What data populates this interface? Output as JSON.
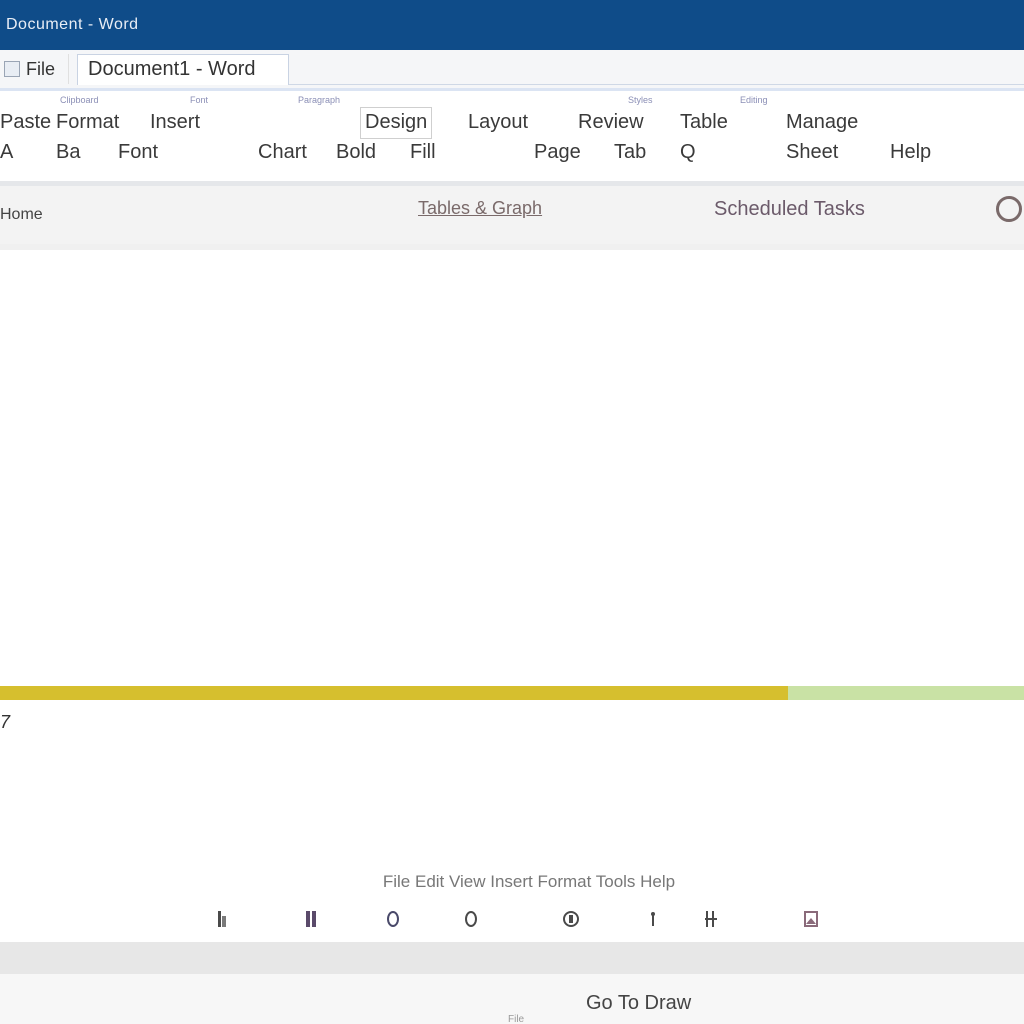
{
  "window": {
    "title": "Document - Word"
  },
  "tabs": {
    "app_tab": "File",
    "active_tab": "Document1 - Word"
  },
  "ribbon": {
    "group_labels": [
      "Clipboard",
      "Font",
      "Paragraph",
      "Styles",
      "Editing"
    ],
    "row1": [
      "Paste",
      "Format",
      "Insert",
      "Design",
      "Layout",
      "Review",
      "Table",
      "Manage"
    ],
    "row2": [
      "A",
      "Ba",
      "Font",
      "Chart",
      "Bold",
      "Fill",
      "Page",
      "Tab",
      "Q",
      "Sheet",
      "Help"
    ]
  },
  "addressbar": {
    "left": "Home",
    "link": "Tables & Graph",
    "right": "Scheduled Tasks",
    "icon": "search-icon"
  },
  "progress": {
    "value": 77,
    "fill_color": "#d6bf2e",
    "track_color": "#c9e2a5",
    "marker": "7"
  },
  "lower": {
    "caption": "File Edit View Insert Format Tools Help",
    "icons": [
      "bold-icon",
      "italic-icon",
      "circle-icon",
      "record-icon",
      "copy-icon",
      "pin-icon",
      "align-icon",
      "image-icon"
    ]
  },
  "footer": {
    "label": "Go To Draw",
    "sub": "File"
  },
  "colors": {
    "titlebar": "#0f4c89"
  }
}
